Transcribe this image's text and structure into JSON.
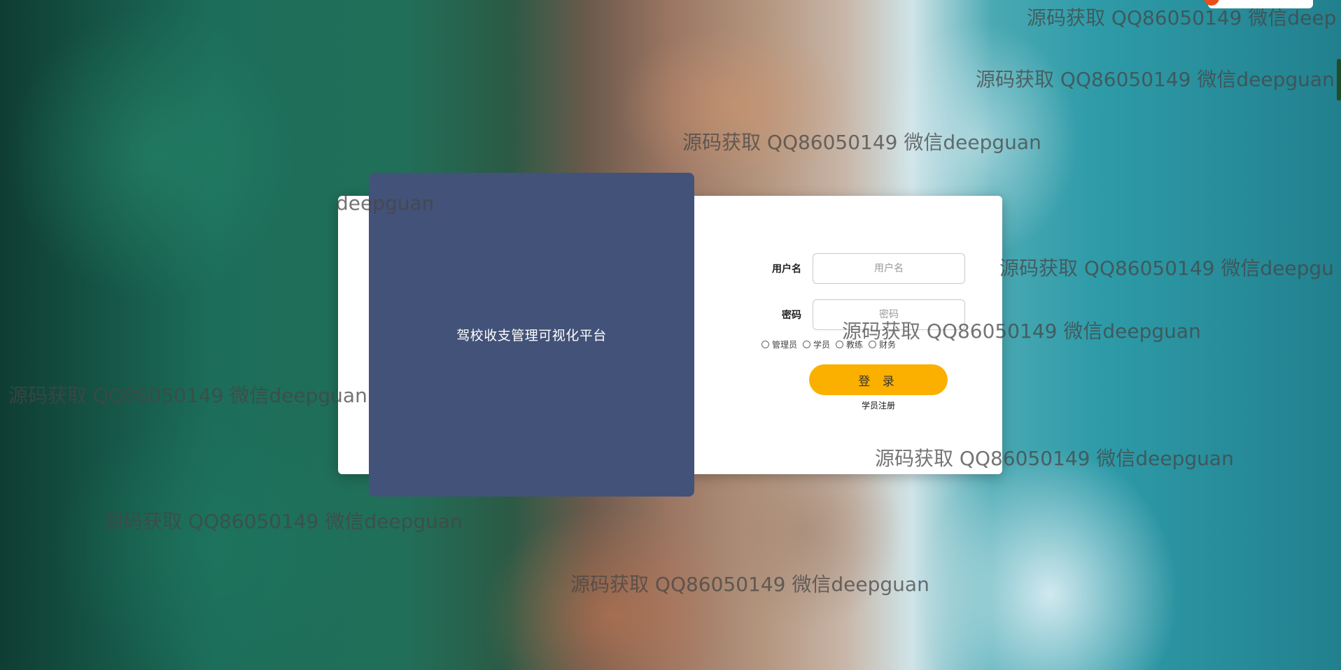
{
  "login": {
    "title": "驾校收支管理可视化平台",
    "username_label": "用户名",
    "username_placeholder": "用户名",
    "password_label": "密码",
    "password_placeholder": "密码",
    "roles": [
      "管理员",
      "学员",
      "教练",
      "财务"
    ],
    "login_button": "登 录",
    "register_link": "学员注册"
  },
  "watermarks": [
    "源码获取 QQ86050149 微信deep",
    "源码获取 QQ86050149 微信deepguan",
    "源码获取 QQ86050149 微信deepguan",
    "deepguan",
    "源码获取 QQ86050149 微信deepgu",
    "源码获取 QQ86050149 微信deepguan",
    "源码获取 QQ86050149 微信deepguan",
    "源码获取 QQ86050149 微信deepguan",
    "源码获取 QQ86050149 微信deepguan",
    "源码获取 QQ86050149 微信deepguan"
  ],
  "colors": {
    "brand_panel": "#435278",
    "login_button": "#fbb000"
  }
}
